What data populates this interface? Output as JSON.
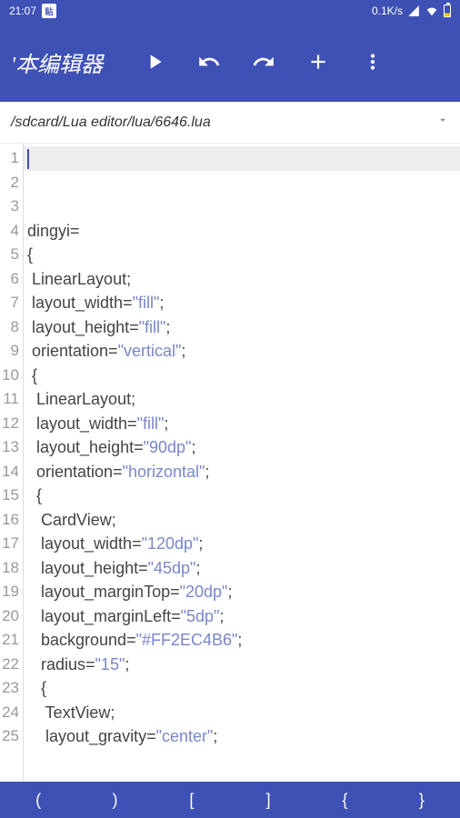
{
  "status": {
    "time": "21:07",
    "badge": "贴",
    "speed": "0.1K/s"
  },
  "app": {
    "title": "'本编辑器"
  },
  "path": "/sdcard/Lua editor/lua/6646.lua",
  "code": {
    "lines": [
      [
        {
          "t": ""
        }
      ],
      [
        {
          "t": ""
        }
      ],
      [
        {
          "t": ""
        }
      ],
      [
        {
          "t": "dingyi="
        }
      ],
      [
        {
          "t": "{"
        }
      ],
      [
        {
          "t": " LinearLayout;"
        }
      ],
      [
        {
          "t": " layout_width="
        },
        {
          "t": "\"fill\"",
          "c": "str"
        },
        {
          "t": ";"
        }
      ],
      [
        {
          "t": " layout_height="
        },
        {
          "t": "\"fill\"",
          "c": "str"
        },
        {
          "t": ";"
        }
      ],
      [
        {
          "t": " orientation="
        },
        {
          "t": "\"vertical\"",
          "c": "str"
        },
        {
          "t": ";"
        }
      ],
      [
        {
          "t": " {"
        }
      ],
      [
        {
          "t": "  LinearLayout;"
        }
      ],
      [
        {
          "t": "  layout_width="
        },
        {
          "t": "\"fill\"",
          "c": "str"
        },
        {
          "t": ";"
        }
      ],
      [
        {
          "t": "  layout_height="
        },
        {
          "t": "\"90dp\"",
          "c": "str"
        },
        {
          "t": ";"
        }
      ],
      [
        {
          "t": "  orientation="
        },
        {
          "t": "\"horizontal\"",
          "c": "str"
        },
        {
          "t": ";"
        }
      ],
      [
        {
          "t": "  {"
        }
      ],
      [
        {
          "t": "   CardView;"
        }
      ],
      [
        {
          "t": "   layout_width="
        },
        {
          "t": "\"120dp\"",
          "c": "str"
        },
        {
          "t": ";"
        }
      ],
      [
        {
          "t": "   layout_height="
        },
        {
          "t": "\"45dp\"",
          "c": "str"
        },
        {
          "t": ";"
        }
      ],
      [
        {
          "t": "   layout_marginTop="
        },
        {
          "t": "\"20dp\"",
          "c": "str"
        },
        {
          "t": ";"
        }
      ],
      [
        {
          "t": "   layout_marginLeft="
        },
        {
          "t": "\"5dp\"",
          "c": "str"
        },
        {
          "t": ";"
        }
      ],
      [
        {
          "t": "   background="
        },
        {
          "t": "\"#FF2EC4B6\"",
          "c": "str"
        },
        {
          "t": ";"
        }
      ],
      [
        {
          "t": "   radius="
        },
        {
          "t": "\"15\"",
          "c": "str"
        },
        {
          "t": ";"
        }
      ],
      [
        {
          "t": "   {"
        }
      ],
      [
        {
          "t": "    TextView;"
        }
      ],
      [
        {
          "t": "    layout_gravity="
        },
        {
          "t": "\"center\"",
          "c": "str"
        },
        {
          "t": ";"
        }
      ]
    ]
  },
  "symbols": [
    "(",
    ")",
    "[",
    "]",
    "{",
    "}"
  ]
}
